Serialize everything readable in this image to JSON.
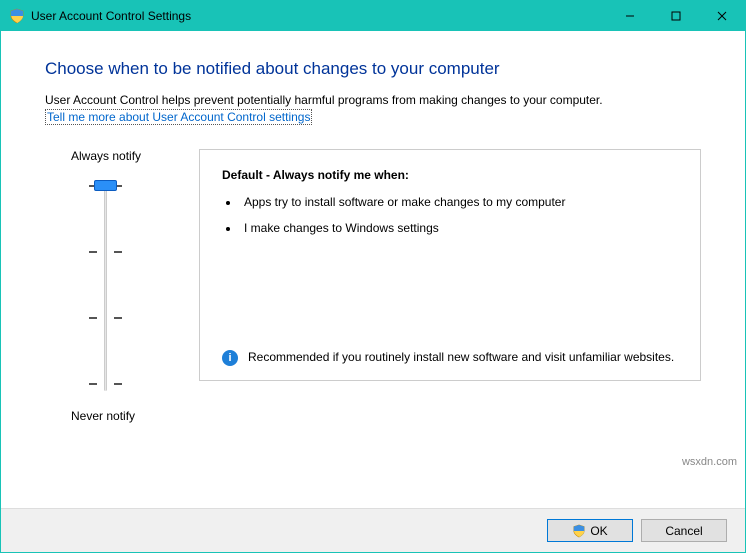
{
  "window": {
    "title": "User Account Control Settings"
  },
  "content": {
    "heading": "Choose when to be notified about changes to your computer",
    "description": "User Account Control helps prevent potentially harmful programs from making changes to your computer.",
    "help_link": "Tell me more about User Account Control settings"
  },
  "slider": {
    "top_label": "Always notify",
    "bottom_label": "Never notify",
    "levels": 4,
    "current_level": 3
  },
  "panel": {
    "title": "Default - Always notify me when:",
    "bullets": [
      "Apps try to install software or make changes to my computer",
      "I make changes to Windows settings"
    ],
    "recommendation": "Recommended if you routinely install new software and visit unfamiliar websites."
  },
  "footer": {
    "ok_label": "OK",
    "cancel_label": "Cancel"
  },
  "watermark": "wsxdn.com"
}
